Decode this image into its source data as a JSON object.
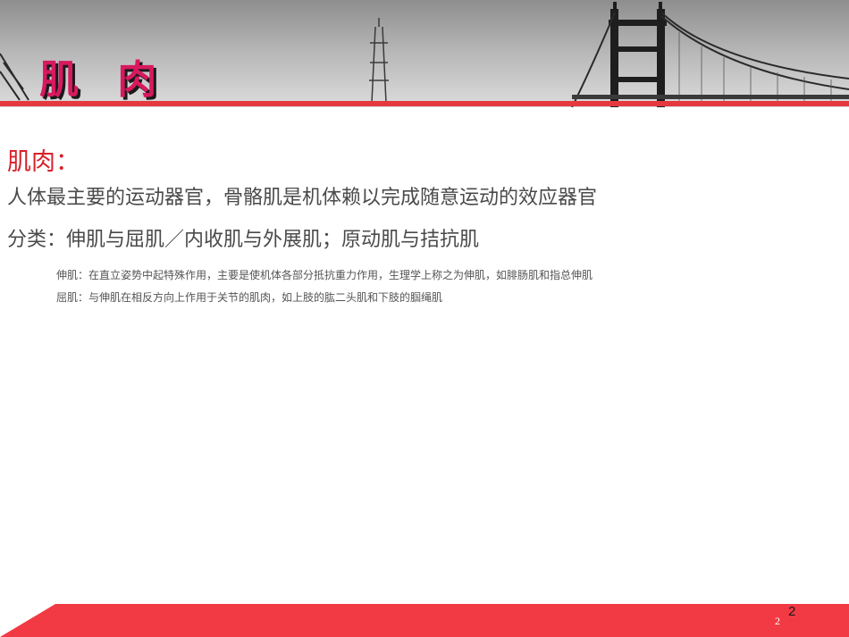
{
  "slide": {
    "title": "肌 肉",
    "section_label": "肌肉：",
    "definition": "人体最主要的运动器官，骨骼肌是机体赖以完成随意运动的效应器官",
    "classification": "分类：伸肌与屈肌／内收肌与外展肌；原动肌与拮抗肌",
    "notes": [
      "伸肌：在直立姿势中起特殊作用，主要是使机体各部分抵抗重力作用，生理学上称之为伸肌，如腓肠肌和指总伸肌",
      "屈肌：与伸肌在相反方向上作用于关节的肌肉，如上肢的肱二头肌和下肢的腘绳肌"
    ],
    "page_number": "2",
    "page_number_small": "2"
  },
  "colors": {
    "accent_red": "#e4393f",
    "title_magenta": "#d8195e",
    "label_red": "#d8202a",
    "body_gray": "#4a4a4a"
  },
  "icons": {
    "header_photo": "golden-gate-bridge-photo"
  }
}
